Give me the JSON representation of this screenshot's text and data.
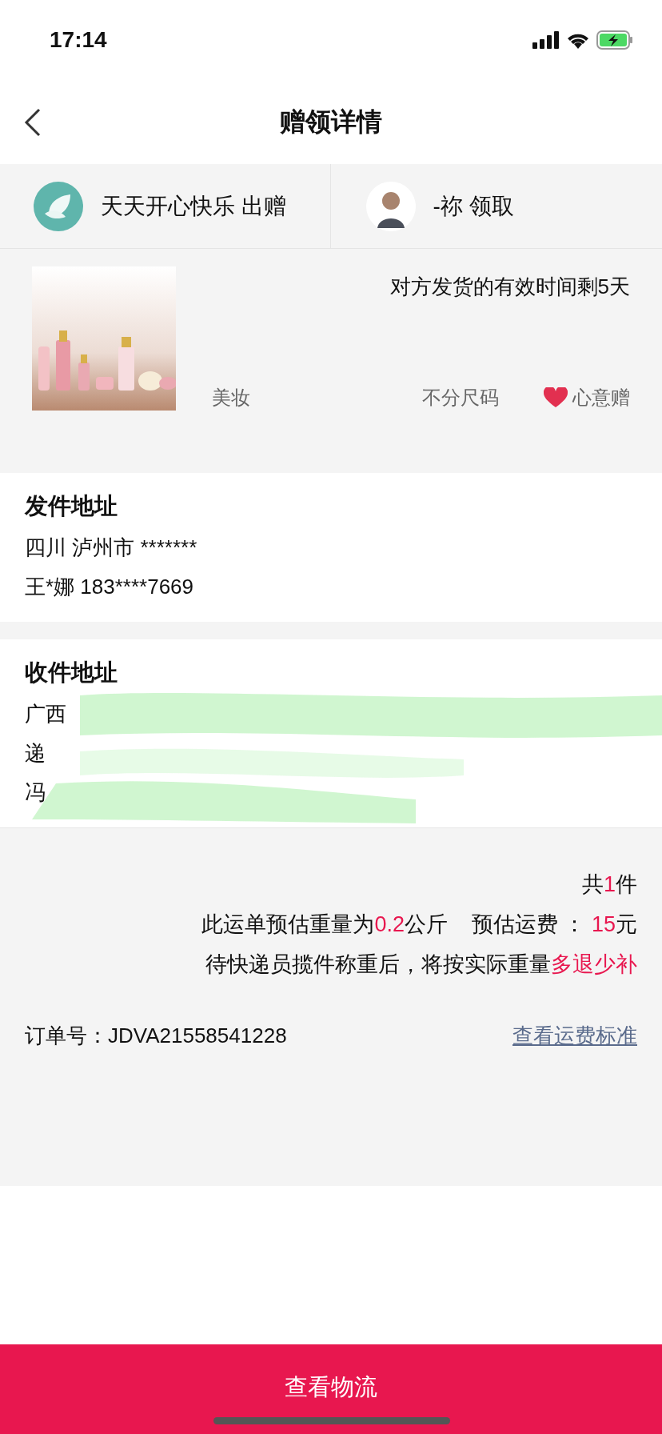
{
  "status_bar": {
    "time": "17:14"
  },
  "nav": {
    "title": "赠领详情"
  },
  "parties": [
    {
      "name": "天天开心快乐",
      "action": "出赠",
      "kind": "leaf"
    },
    {
      "name": "-祢",
      "action": "领取",
      "kind": "person"
    }
  ],
  "gift": {
    "notice": "对方发货的有效时间剩5天",
    "category": "美妆",
    "size": "不分尺码",
    "type": "心意赠"
  },
  "sender": {
    "title": "发件地址",
    "lines": [
      "四川 泸州市 *******",
      "王*娜 183****7669"
    ]
  },
  "receiver": {
    "title": "收件地址",
    "lines": [
      "广西",
      "递",
      "冯"
    ]
  },
  "summary": {
    "lines": [
      [
        {
          "text": "共"
        },
        {
          "text": "1",
          "highlight": true
        },
        {
          "text": "件"
        }
      ],
      [
        {
          "text": "此运单预估重量为"
        },
        {
          "text": "0.2",
          "highlight": true
        },
        {
          "text": "公斤    预估运费 ： "
        },
        {
          "text": "15",
          "highlight": true
        },
        {
          "text": "元"
        }
      ],
      [
        {
          "text": "待快递员揽件称重后，将按实际重量"
        },
        {
          "text": "多退少补",
          "highlight": true
        }
      ]
    ],
    "order_label": "订单号：",
    "order_number": "JDVA21558541228",
    "fee_link": "查看运费标准"
  },
  "action_button": "查看物流"
}
